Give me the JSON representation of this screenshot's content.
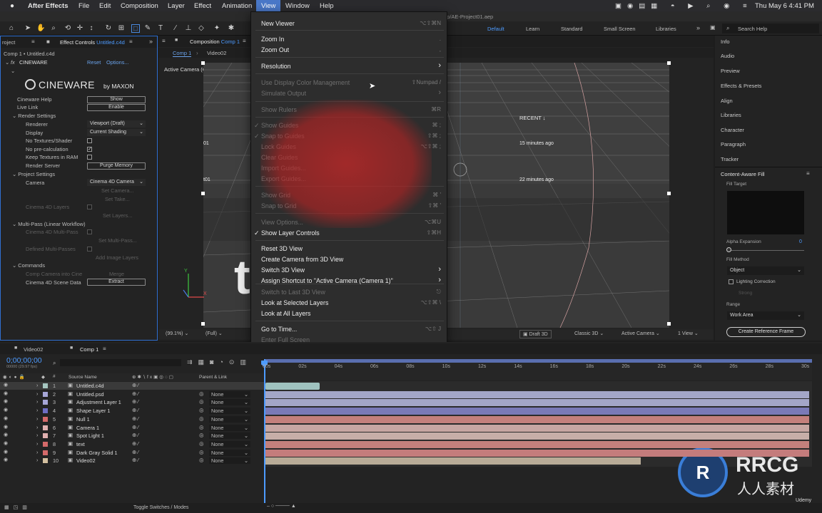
{
  "app": {
    "name": "After Effects",
    "file_title": "op/AE-Project01.aep"
  },
  "menubar": {
    "items": [
      "After Effects",
      "File",
      "Edit",
      "Composition",
      "Layer",
      "Effect",
      "Animation",
      "View",
      "Window",
      "Help"
    ],
    "datetime": "Thu May 6  4:41 PM"
  },
  "workspaces": [
    "Default",
    "Learn",
    "Standard",
    "Small Screen",
    "Libraries"
  ],
  "search_help": {
    "placeholder": "Search Help"
  },
  "project_tab": "roject",
  "effect_controls": {
    "tab_label": "Effect Controls",
    "tab_layer": "Untitled.c4d",
    "breadcrumb": "Comp 1 • Untitled.c4d",
    "effect_name": "CINEWARE",
    "reset": "Reset",
    "options": "Options...",
    "logo": "CINEWARE",
    "logo_by": "by MAXON",
    "rows": {
      "cineware_help": "Cineware Help",
      "show": "Show",
      "live_link": "Live Link",
      "enable": "Enable",
      "render_settings": "Render Settings",
      "renderer": "Renderer",
      "renderer_val": "Viewport (Draft)",
      "display": "Display",
      "display_val": "Current Shading",
      "no_textures": "No Textures/Shader",
      "no_precalc": "No pre-calculation",
      "keep_textures": "Keep Textures in RAM",
      "render_server": "Render Server",
      "purge_memory": "Purge Memory",
      "project_settings": "Project Settings",
      "camera": "Camera",
      "camera_val": "Cinema 4D Camera",
      "set_camera": "Set Camera...",
      "set_take": "Set Take...",
      "c4d_layers": "Cinema 4D Layers",
      "set_layers": "Set Layers...",
      "multipass": "Multi-Pass (Linear Workflow)",
      "c4d_multipass": "Cinema 4D Multi-Pass",
      "set_multipass": "Set Multi-Pass...",
      "defined_multipasses": "Defined Multi-Passes",
      "add_image_layers": "Add Image Layers",
      "commands": "Commands",
      "comp_camera": "Comp Camera into Cine",
      "merge": "Merge",
      "c4d_scene_data": "Cinema 4D Scene Data",
      "extract": "Extract"
    }
  },
  "composition": {
    "tab_label": "Composition",
    "tab_comp": "Comp 1",
    "subtabs": [
      "Comp 1",
      "Video02"
    ],
    "camera_label": "Active Camera (Camera 1)",
    "overlay": {
      "recent": "RECENT",
      "t15": "15 minutes ago",
      "t22": "22 minutes ago",
      "frag1": "01",
      "frag2": "t01"
    },
    "big_letter": "t",
    "footer": {
      "zoom": "(99.1%)",
      "quality": "(Full)",
      "draft3d": "Draft 3D",
      "renderer": "Classic 3D",
      "camera": "Active Camera",
      "views": "1 View"
    }
  },
  "view_menu": {
    "items": [
      {
        "label": "New Viewer",
        "shortcut": "⌥⇧⌘N",
        "enabled": true
      },
      {
        "label": "Zoom In",
        "shortcut": ".",
        "enabled": true
      },
      {
        "label": "Zoom Out",
        "shortcut": ",",
        "enabled": true
      },
      {
        "label": "Resolution",
        "shortcut": "›",
        "enabled": true
      },
      {
        "label": "Use Display Color Management",
        "shortcut": "⇧Numpad /",
        "enabled": false
      },
      {
        "label": "Simulate Output",
        "shortcut": "›",
        "enabled": false
      },
      {
        "label": "Show Rulers",
        "shortcut": "⌘R",
        "enabled": false
      },
      {
        "label": "Show Guides",
        "shortcut": "⌘ ;",
        "enabled": false,
        "checked": true
      },
      {
        "label": "Snap to Guides",
        "shortcut": "⇧⌘ ;",
        "enabled": false,
        "checked": true
      },
      {
        "label": "Lock Guides",
        "shortcut": "⌥⇧⌘ ;",
        "enabled": false
      },
      {
        "label": "Clear Guides",
        "shortcut": "",
        "enabled": false
      },
      {
        "label": "Import Guides...",
        "shortcut": "",
        "enabled": false
      },
      {
        "label": "Export Guides...",
        "shortcut": "",
        "enabled": false
      },
      {
        "label": "Show Grid",
        "shortcut": "⌘ '",
        "enabled": false
      },
      {
        "label": "Snap to Grid",
        "shortcut": "⇧⌘ '",
        "enabled": false
      },
      {
        "label": "View Options...",
        "shortcut": "⌥⌘U",
        "enabled": false
      },
      {
        "label": "Show Layer Controls",
        "shortcut": "⇧⌘H",
        "enabled": true,
        "checked": true
      },
      {
        "label": "Reset 3D View",
        "shortcut": "",
        "enabled": true
      },
      {
        "label": "Create Camera from 3D View",
        "shortcut": "",
        "enabled": true
      },
      {
        "label": "Switch 3D View",
        "shortcut": "›",
        "enabled": true
      },
      {
        "label": "Assign Shortcut to \"Active Camera (Camera 1)\"",
        "shortcut": "›",
        "enabled": true
      },
      {
        "label": "Switch to Last 3D View",
        "shortcut": "⎋",
        "enabled": false
      },
      {
        "label": "Look at Selected Layers",
        "shortcut": "⌥⇧⌘ \\",
        "enabled": true
      },
      {
        "label": "Look at All Layers",
        "shortcut": "",
        "enabled": true
      },
      {
        "label": "Go to Time...",
        "shortcut": "⌥⇧ J",
        "enabled": true
      },
      {
        "label": "Enter Full Screen",
        "shortcut": "",
        "enabled": false
      }
    ]
  },
  "right_panels": {
    "items": [
      "Info",
      "Audio",
      "Preview",
      "Effects & Presets",
      "Align",
      "Libraries",
      "Character",
      "Paragraph",
      "Tracker"
    ],
    "caf": {
      "title": "Content-Aware Fill",
      "fill_target": "Fill Target",
      "alpha_expansion": "Alpha Expansion",
      "alpha_value": "0",
      "fill_method": "Fill Method",
      "fill_method_val": "Object",
      "lighting_correction": "Lighting Correction",
      "strong": "Strong",
      "range": "Range",
      "range_val": "Work Area",
      "create_button": "Create Reference Frame"
    }
  },
  "timeline": {
    "tabs": [
      "Video02",
      "Comp 1"
    ],
    "timecode": "0;00;00;00",
    "fps": "00000 (29.97 fps)",
    "col_source": "Source Name",
    "col_parent": "Parent & Link",
    "toggle": "Toggle Switches / Modes",
    "ruler": [
      "00s",
      "02s",
      "04s",
      "06s",
      "08s",
      "10s",
      "12s",
      "14s",
      "16s",
      "18s",
      "20s",
      "22s",
      "24s",
      "26s",
      "28s",
      "30s"
    ],
    "layers": [
      {
        "num": "1",
        "name": "Untitled.c4d",
        "label_color": "#a6c6c0",
        "parent": "",
        "bar_color": "#9fc2bf",
        "bar_end": 0.1
      },
      {
        "num": "2",
        "name": "Untitled.psd",
        "label_color": "#a6a6d6",
        "parent": "None",
        "bar_color": "#a3a6c7",
        "bar_end": 1.0
      },
      {
        "num": "3",
        "name": "Adjustment Layer 1",
        "label_color": "#a6a6d6",
        "parent": "None",
        "bar_color": "#a3a6c7",
        "bar_end": 1.0
      },
      {
        "num": "4",
        "name": "Shape Layer 1",
        "label_color": "#6e6ec4",
        "parent": "None",
        "bar_color": "#7a7ab7",
        "bar_end": 1.0
      },
      {
        "num": "5",
        "name": "Null 1",
        "label_color": "#d46a6a",
        "parent": "None",
        "bar_color": "#c4807c",
        "bar_end": 1.0
      },
      {
        "num": "6",
        "name": "Camera 1",
        "label_color": "#e0b0b0",
        "parent": "None",
        "bar_color": "#c7a6a2",
        "bar_end": 1.0
      },
      {
        "num": "7",
        "name": "Spot Light 1",
        "label_color": "#e0b0b0",
        "parent": "None",
        "bar_color": "#c7aea8",
        "bar_end": 1.0
      },
      {
        "num": "8",
        "name": "text",
        "label_color": "#d46a6a",
        "parent": "None",
        "bar_color": "#c4807c",
        "bar_end": 1.0
      },
      {
        "num": "9",
        "name": "Dark Gray Solid 1",
        "label_color": "#d46a6a",
        "parent": "None",
        "bar_color": "#c47c7c",
        "bar_end": 1.0
      },
      {
        "num": "10",
        "name": "Video02",
        "label_color": "#d4c0a0",
        "parent": "None",
        "bar_color": "#b8ab97",
        "bar_end": 0.69
      }
    ]
  },
  "watermark": {
    "logo": "RRCG",
    "sub": "人人素材",
    "udemy": "Udemy"
  }
}
